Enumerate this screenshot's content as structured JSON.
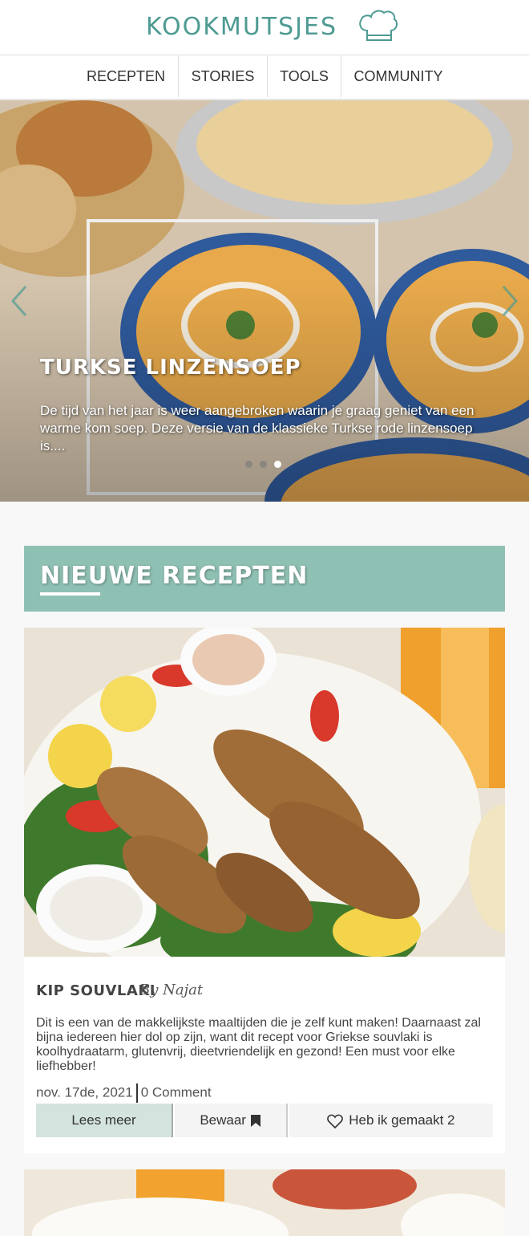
{
  "header": {
    "logo_text": "KOOKMUTSJES",
    "logo_icon": "chef-hat-icon",
    "brand_color": "#4e9b93"
  },
  "nav": {
    "items": [
      {
        "label": "RECEPTEN"
      },
      {
        "label": "STORIES"
      },
      {
        "label": "TOOLS"
      },
      {
        "label": "COMMUNITY"
      }
    ]
  },
  "hero": {
    "title": "TURKSE LINZENSOEP",
    "text": "De tijd van het jaar is weer aangebroken waarin je graag geniet van een warme kom soep. Deze versie van de klassieke Turkse rode linzensoep is....",
    "prev_icon": "chevron-left-icon",
    "next_icon": "chevron-right-icon",
    "slide_count": 3,
    "active_slide": 3
  },
  "section": {
    "title": "NIEUWE RECEPTEN",
    "color": "#8fc0b4"
  },
  "recipe": {
    "title": "KIP SOUVLAKI",
    "author": "By Najat",
    "description": "Dit is een van de makkelijkste maaltijden die je zelf kunt maken! Daarnaast zal bijna iedereen hier dol op zijn, want dit recept voor Griekse souvlaki is koolhydraatarm, glutenvrij, dieetvriendelijk en gezond! Een must voor elke liefhebber!",
    "date": "nov. 17de, 2021",
    "comments": "0 Comment",
    "read_more": "Lees meer",
    "save": "Bewaar",
    "made": "Heb ik gemaakt 2"
  }
}
